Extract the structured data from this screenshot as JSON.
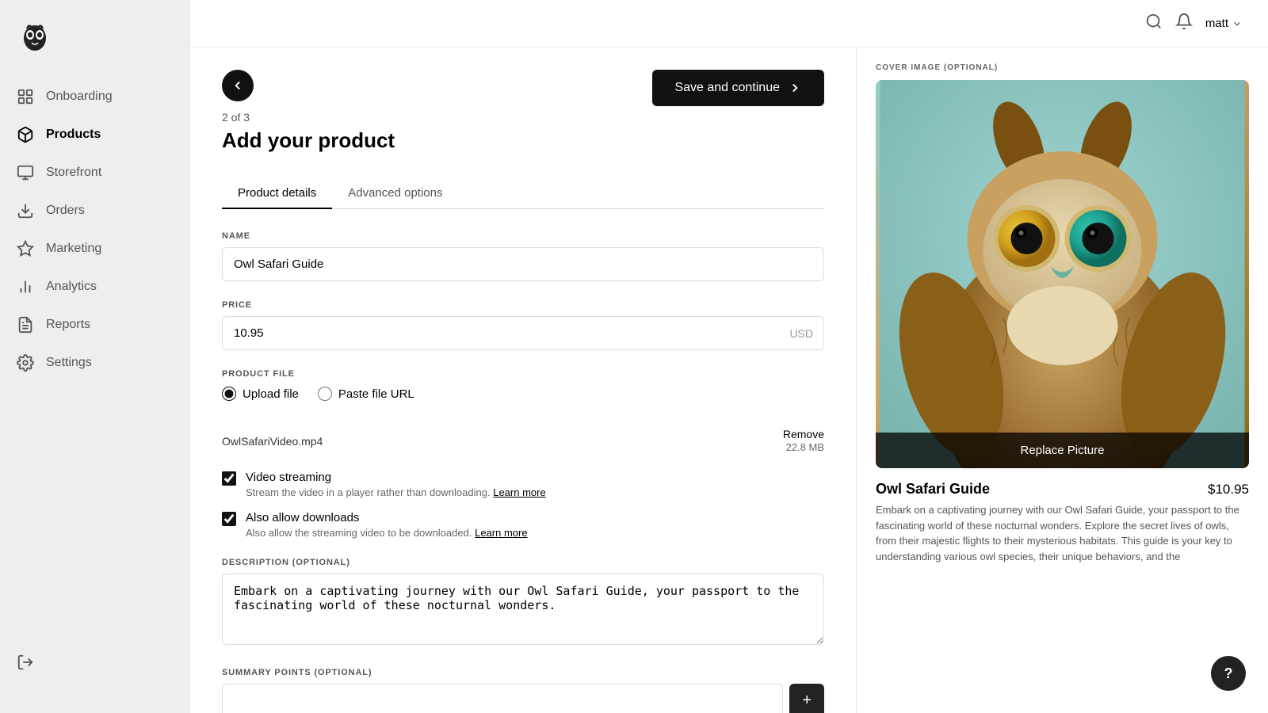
{
  "sidebar": {
    "logo_alt": "Owl logo",
    "items": [
      {
        "id": "onboarding",
        "label": "Onboarding",
        "icon": "chart-icon",
        "active": false
      },
      {
        "id": "products",
        "label": "Products",
        "icon": "box-icon",
        "active": true
      },
      {
        "id": "storefront",
        "label": "Storefront",
        "icon": "monitor-icon",
        "active": false
      },
      {
        "id": "orders",
        "label": "Orders",
        "icon": "download-icon",
        "active": false
      },
      {
        "id": "marketing",
        "label": "Marketing",
        "icon": "star-icon",
        "active": false
      },
      {
        "id": "analytics",
        "label": "Analytics",
        "icon": "bar-chart-icon",
        "active": false
      },
      {
        "id": "reports",
        "label": "Reports",
        "icon": "doc-icon",
        "active": false
      },
      {
        "id": "settings",
        "label": "Settings",
        "icon": "gear-icon",
        "active": false
      }
    ],
    "logout_icon": "logout-icon"
  },
  "header": {
    "search_icon": "search-icon",
    "bell_icon": "bell-icon",
    "user": "matt"
  },
  "page": {
    "back_icon": "back-arrow-icon",
    "step": "2 of 3",
    "title": "Add your product",
    "save_button": "Save and continue",
    "tabs": [
      {
        "id": "product-details",
        "label": "Product details",
        "active": true
      },
      {
        "id": "advanced-options",
        "label": "Advanced options",
        "active": false
      }
    ]
  },
  "form": {
    "name_label": "NAME",
    "name_value": "Owl Safari Guide",
    "name_placeholder": "",
    "price_label": "PRICE",
    "price_value": "10.95",
    "price_currency": "USD",
    "product_file_label": "PRODUCT FILE",
    "upload_file_label": "Upload file",
    "paste_url_label": "Paste file URL",
    "file_name": "OwlSafariVideo.mp4",
    "file_remove": "Remove",
    "file_size": "22.8 MB",
    "video_streaming_label": "Video streaming",
    "video_streaming_desc": "Stream the video in a player rather than downloading.",
    "video_streaming_learn_more": "Learn more",
    "video_streaming_checked": true,
    "also_allow_label": "Also allow downloads",
    "also_allow_desc": "Also allow the streaming video to be downloaded.",
    "also_allow_learn_more": "Learn more",
    "also_allow_checked": true,
    "description_label": "DESCRIPTION (OPTIONAL)",
    "description_value": "Embark on a captivating journey with our Owl Safari Guide, your passport to the fascinating world of these nocturnal wonders.",
    "summary_label": "SUMMARY POINTS (OPTIONAL)"
  },
  "preview": {
    "cover_label": "COVER IMAGE (OPTIONAL)",
    "replace_button": "Replace Picture",
    "product_title": "Owl Safari Guide",
    "product_price": "$10.95",
    "product_desc": "Embark on a captivating journey with our Owl Safari Guide, your passport to the fascinating world of these nocturnal wonders. Explore the secret lives of owls, from their majestic flights to their mysterious habitats. This guide is your key to understanding various owl species, their unique behaviors, and the"
  },
  "help": {
    "label": "?"
  }
}
